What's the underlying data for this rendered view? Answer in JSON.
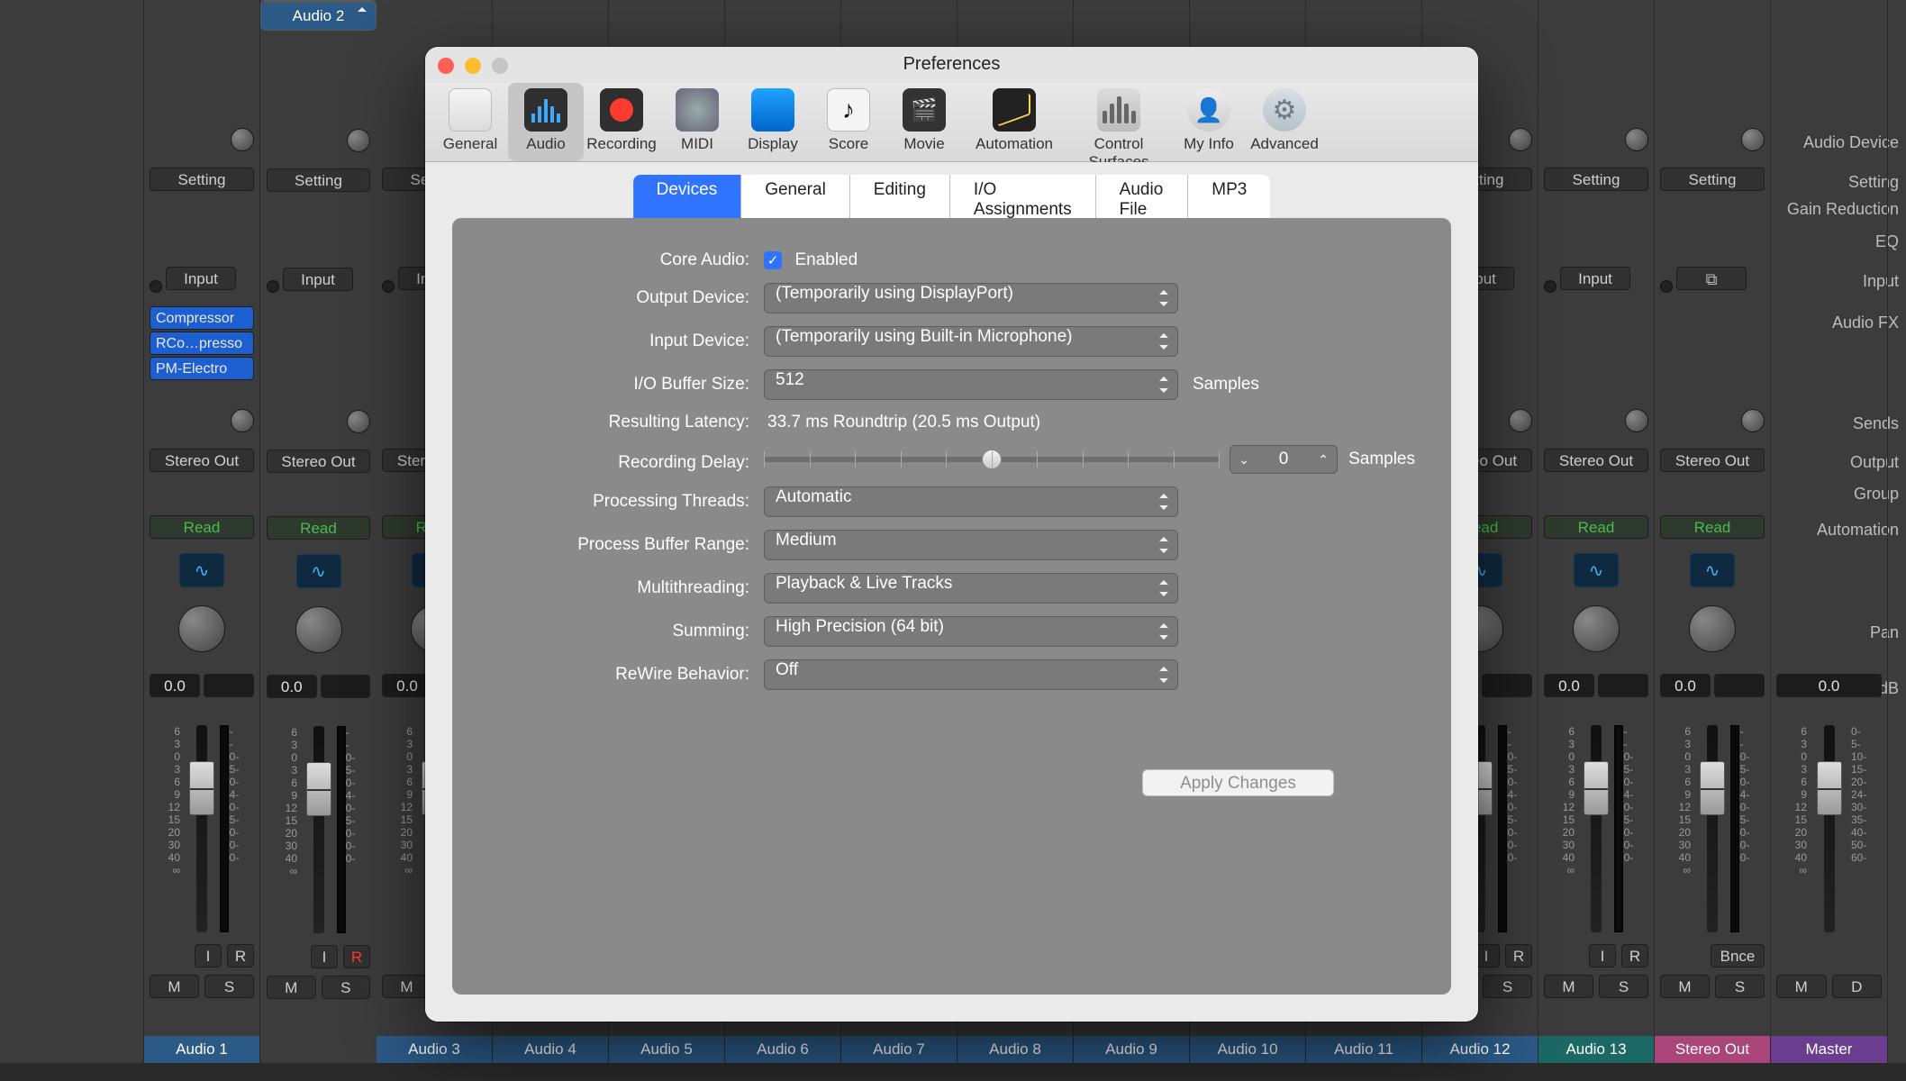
{
  "mixer": {
    "row_labels": {
      "audio_device": "Audio Device",
      "setting": "Setting",
      "gain_reduction": "Gain Reduction",
      "eq": "EQ",
      "input": "Input",
      "audio_fx": "Audio FX",
      "sends": "Sends",
      "output": "Output",
      "group": "Group",
      "automation": "Automation",
      "pan": "Pan",
      "db": "dB"
    },
    "fader_scale_left": [
      "6",
      "3",
      "0",
      "3",
      "6",
      "9",
      "12",
      "15",
      "20",
      "30",
      "40",
      "∞"
    ],
    "fader_scale_right": [
      "0-",
      "5-",
      "10-",
      "15-",
      "20-",
      "24-",
      "30-",
      "35-",
      "40-",
      "50-",
      "60-"
    ],
    "btn": {
      "setting": "Setting",
      "input": "Input",
      "stereo_out": "Stereo Out",
      "read": "Read",
      "i": "I",
      "r": "R",
      "m": "M",
      "s": "S",
      "d": "D",
      "bnce": "Bnce"
    },
    "fx": {
      "compressor": "Compressor",
      "rcompresso": "RCo…presso",
      "pm_electro": "PM-Electro"
    },
    "db_value": "0.0",
    "tracks": [
      {
        "name": "Audio 1",
        "color": "tn-blue",
        "rec": false
      },
      {
        "name": "Audio 2",
        "color": "tn-blue",
        "rec": true,
        "selected": true
      },
      {
        "name": "Audio 3",
        "color": "tn-blue"
      },
      {
        "name": "Audio 4",
        "color": "tn-blue"
      },
      {
        "name": "Audio 5",
        "color": "tn-blue"
      },
      {
        "name": "Audio 6",
        "color": "tn-blue"
      },
      {
        "name": "Audio 7",
        "color": "tn-blue"
      },
      {
        "name": "Audio 8",
        "color": "tn-blue"
      },
      {
        "name": "Audio 9",
        "color": "tn-blue"
      },
      {
        "name": "Audio 10",
        "color": "tn-blue"
      },
      {
        "name": "Audio 11",
        "color": "tn-blue"
      },
      {
        "name": "Audio 12",
        "color": "tn-blue"
      },
      {
        "name": "Audio 13",
        "color": "tn-teal"
      },
      {
        "name": "Stereo Out",
        "color": "tn-pink",
        "stereo": true
      },
      {
        "name": "Master",
        "color": "tn-purple",
        "master": true
      }
    ]
  },
  "prefs": {
    "title": "Preferences",
    "toolbar": [
      {
        "id": "general",
        "label": "General"
      },
      {
        "id": "audio",
        "label": "Audio",
        "active": true
      },
      {
        "id": "recording",
        "label": "Recording"
      },
      {
        "id": "midi",
        "label": "MIDI"
      },
      {
        "id": "display",
        "label": "Display"
      },
      {
        "id": "score",
        "label": "Score"
      },
      {
        "id": "movie",
        "label": "Movie"
      },
      {
        "id": "automation",
        "label": "Automation"
      },
      {
        "id": "control_surfaces",
        "label": "Control Surfaces"
      },
      {
        "id": "my_info",
        "label": "My Info"
      },
      {
        "id": "advanced",
        "label": "Advanced"
      }
    ],
    "subtabs": [
      "Devices",
      "General",
      "Editing",
      "I/O Assignments",
      "Audio File Editor",
      "MP3"
    ],
    "active_subtab": "Devices",
    "labels": {
      "core_audio": "Core Audio:",
      "enabled": "Enabled",
      "output_device": "Output Device:",
      "input_device": "Input Device:",
      "io_buffer": "I/O Buffer Size:",
      "samples": "Samples",
      "resulting_latency": "Resulting Latency:",
      "recording_delay": "Recording Delay:",
      "processing_threads": "Processing Threads:",
      "process_buffer_range": "Process Buffer Range:",
      "multithreading": "Multithreading:",
      "summing": "Summing:",
      "rewire": "ReWire Behavior:",
      "apply_changes": "Apply Changes"
    },
    "values": {
      "output_device": "(Temporarily using DisplayPort)",
      "input_device": "(Temporarily using Built-in Microphone)",
      "io_buffer": "512",
      "resulting_latency": "33.7 ms Roundtrip (20.5 ms Output)",
      "recording_delay": "0",
      "processing_threads": "Automatic",
      "process_buffer_range": "Medium",
      "multithreading": "Playback & Live Tracks",
      "summing": "High Precision (64 bit)",
      "rewire": "Off"
    }
  }
}
